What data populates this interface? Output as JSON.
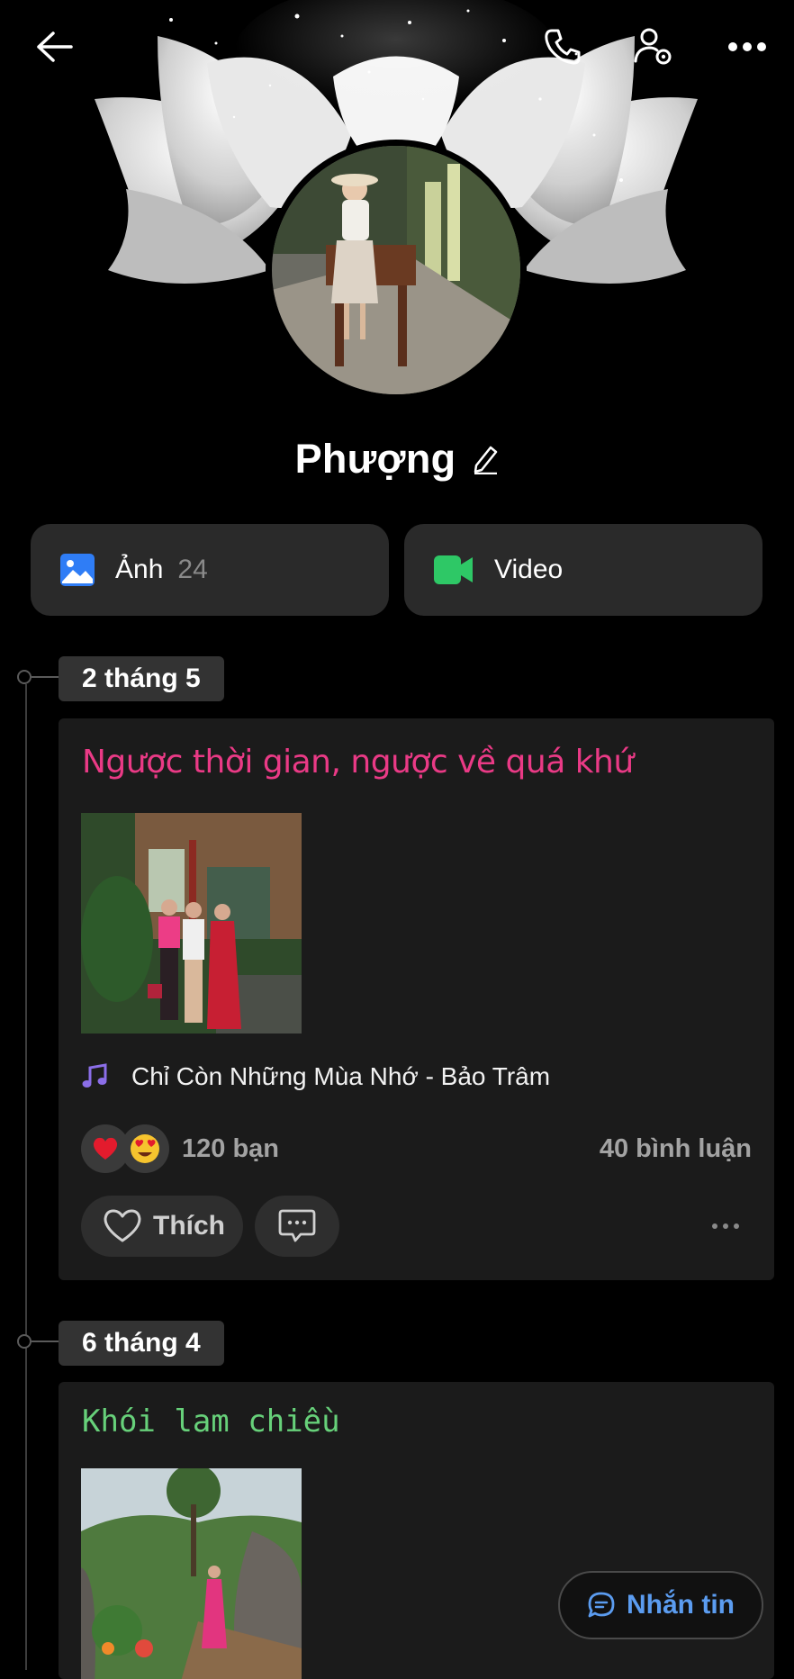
{
  "profile": {
    "name": "Phượng"
  },
  "media": {
    "photos_label": "Ảnh",
    "photos_count": "24",
    "video_label": "Video"
  },
  "posts": [
    {
      "date": "2 tháng 5",
      "title": "Ngược thời gian, ngược về quá khứ",
      "music": "Chỉ Còn Những Mùa Nhớ - Bảo Trâm",
      "reactions_count": "120 bạn",
      "comments_count": "40 bình luận",
      "like_label": "Thích"
    },
    {
      "date": "6 tháng 4",
      "title": "Khói lam chiều"
    }
  ],
  "floating": {
    "message_label": "Nhắn tin"
  },
  "colors": {
    "post1_title": "#ea3a86",
    "post2_title": "#67d17a",
    "accent_blue": "#5b9cf0",
    "photos_icon": "#2f7df6",
    "video_icon": "#2ec866",
    "music_icon": "#8b6ee8"
  },
  "icons": [
    "back-arrow-icon",
    "phone-icon",
    "user-settings-icon",
    "more-icon",
    "edit-pencil-icon",
    "image-icon",
    "video-camera-icon",
    "music-note-icon",
    "heart-reaction-icon",
    "heart-eyes-reaction-icon",
    "heart-outline-icon",
    "comment-icon",
    "chat-bubble-icon"
  ]
}
